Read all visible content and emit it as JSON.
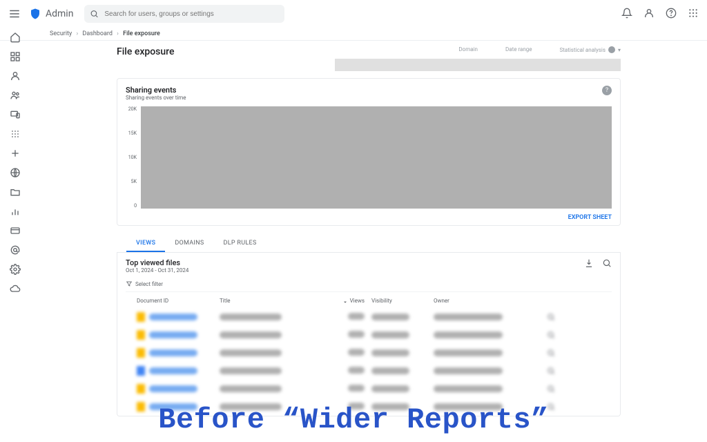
{
  "header": {
    "app_name": "Admin",
    "search_placeholder": "Search for users, groups or settings"
  },
  "breadcrumb": {
    "a": "Security",
    "b": "Dashboard",
    "c": "File exposure"
  },
  "sidebar_icons": [
    "home",
    "dashboard",
    "person",
    "group",
    "devices",
    "apps",
    "plus",
    "globe",
    "folder",
    "bar-chart",
    "card",
    "at",
    "admin",
    "cloud"
  ],
  "page": {
    "title": "File exposure"
  },
  "filters": {
    "domain": "Domain",
    "date_range": "Date range",
    "stat": "Statistical analysis"
  },
  "chart_card": {
    "title": "Sharing events",
    "subtitle": "Sharing events over time",
    "export": "EXPORT SHEET",
    "y_ticks": [
      "20K",
      "15K",
      "10K",
      "5K",
      "0"
    ]
  },
  "tabs": {
    "views": "VIEWS",
    "domains": "DOMAINS",
    "dlp": "DLP RULES"
  },
  "panel": {
    "title": "Top viewed files",
    "date_sub": "Oct 1, 2024 - Oct 31, 2024",
    "filter_label": "Select filter",
    "columns": {
      "doc": "Document ID",
      "title": "Title",
      "views": "Views",
      "vis": "Visibility",
      "owner": "Owner"
    },
    "rows": [
      {
        "icon": "sheet"
      },
      {
        "icon": "sheet"
      },
      {
        "icon": "sheet"
      },
      {
        "icon": "doc"
      },
      {
        "icon": "sheet"
      },
      {
        "icon": "sheet"
      }
    ]
  },
  "caption": "Before “Wider Reports”",
  "chart_data": {
    "type": "bar",
    "title": "Sharing events over time",
    "ylabel": "Sharing events",
    "ylim": [
      0,
      20000
    ],
    "y_ticks": [
      0,
      5000,
      10000,
      15000,
      20000
    ],
    "note": "chart area obscured in source image; no data points visible"
  }
}
